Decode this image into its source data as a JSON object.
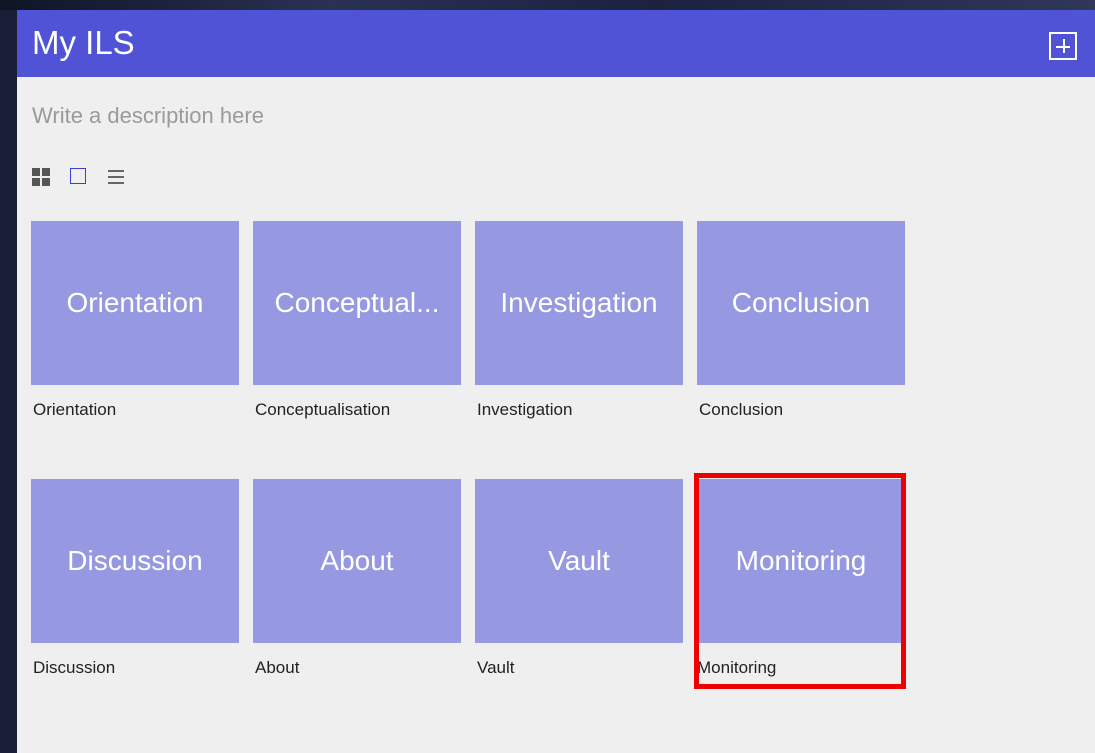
{
  "app": {
    "title": "My ILS",
    "description_placeholder": "Write a description here"
  },
  "toolbar": {
    "add_icon": "add-square-icon",
    "view_modes": [
      {
        "icon": "grid-view-icon",
        "active": false
      },
      {
        "icon": "single-view-icon",
        "active": true
      },
      {
        "icon": "list-view-icon",
        "active": false
      }
    ]
  },
  "tiles": [
    {
      "thumb_label": "Orientation",
      "caption": "Orientation"
    },
    {
      "thumb_label": "Conceptual...",
      "caption": "Conceptualisation"
    },
    {
      "thumb_label": "Investigation",
      "caption": "Investigation"
    },
    {
      "thumb_label": "Conclusion",
      "caption": "Conclusion"
    },
    {
      "thumb_label": "Discussion",
      "caption": "Discussion"
    },
    {
      "thumb_label": "About",
      "caption": "About"
    },
    {
      "thumb_label": "Vault",
      "caption": "Vault"
    },
    {
      "thumb_label": "Monitoring",
      "caption": "Monitoring",
      "highlighted": true
    }
  ],
  "colors": {
    "header": "#5053d6",
    "tile": "#9698e2",
    "highlight": "#ee0000",
    "panel": "#efefef"
  }
}
